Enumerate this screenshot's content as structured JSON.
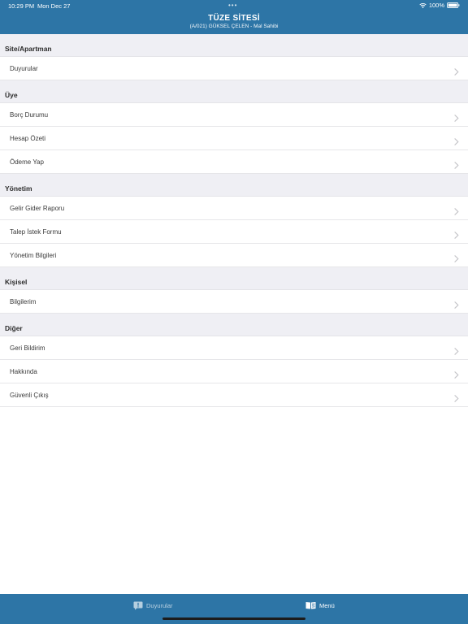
{
  "status_bar": {
    "time": "10:29 PM",
    "date": "Mon Dec 27",
    "battery": "100%"
  },
  "header": {
    "title": "TÜZE SİTESİ",
    "subtitle": "(A/021) GÜKSEL ÇELEN - Mal Sahibi"
  },
  "sections": [
    {
      "title": "Site/Apartman",
      "items": [
        "Duyurular"
      ]
    },
    {
      "title": "Üye",
      "items": [
        "Borç Durumu",
        "Hesap Özeti",
        "Ödeme Yap"
      ]
    },
    {
      "title": "Yönetim",
      "items": [
        "Gelir Gider Raporu",
        "Talep İstek Formu",
        "Yönetim Bilgileri"
      ]
    },
    {
      "title": "Kişisel",
      "items": [
        "Bilgilerim"
      ]
    },
    {
      "title": "Diğer",
      "items": [
        "Geri Bildirim",
        "Hakkında",
        "Güvenli Çıkış"
      ]
    }
  ],
  "tabbar": {
    "tabs": [
      {
        "label": "Duyurular",
        "icon": "announcement-icon",
        "active": false
      },
      {
        "label": "Menü",
        "icon": "book-icon",
        "active": true
      }
    ]
  },
  "colors": {
    "brand": "#2d75a6",
    "section_bg": "#efeff4",
    "chevron": "#c4c4c8"
  }
}
